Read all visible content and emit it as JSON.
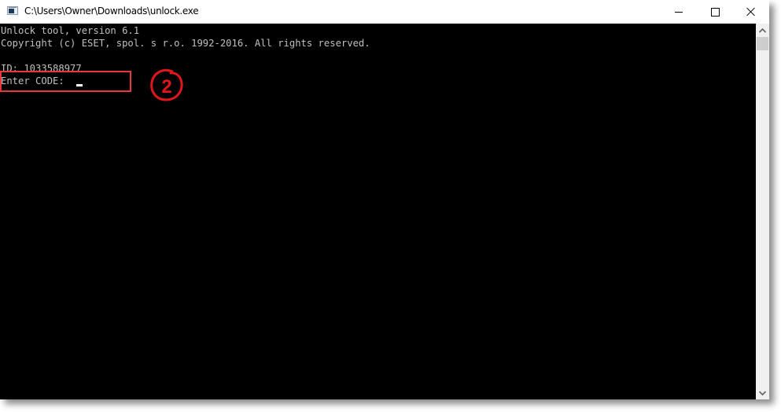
{
  "window": {
    "title": "C:\\Users\\Owner\\Downloads\\unlock.exe",
    "icon": "console-app-icon",
    "controls": {
      "minimize": "minimize-icon",
      "maximize": "maximize-icon",
      "close": "close-icon"
    }
  },
  "console": {
    "lines": [
      "Unlock tool, version 6.1",
      "Copyright (c) ESET, spol. s r.o. 1992-2016. All rights reserved.",
      "",
      "ID: 1033588977",
      "Enter CODE: "
    ],
    "input_value": "",
    "colors": {
      "background": "#000000",
      "text": "#c0c0c0",
      "cursor": "#ffffff"
    }
  },
  "annotation": {
    "step_number": "2",
    "highlight_color": "#e8373b",
    "badge_color": "#e0161b"
  },
  "scrollbar": {
    "up_icon": "chevron-up-icon",
    "down_icon": "chevron-down-icon"
  }
}
